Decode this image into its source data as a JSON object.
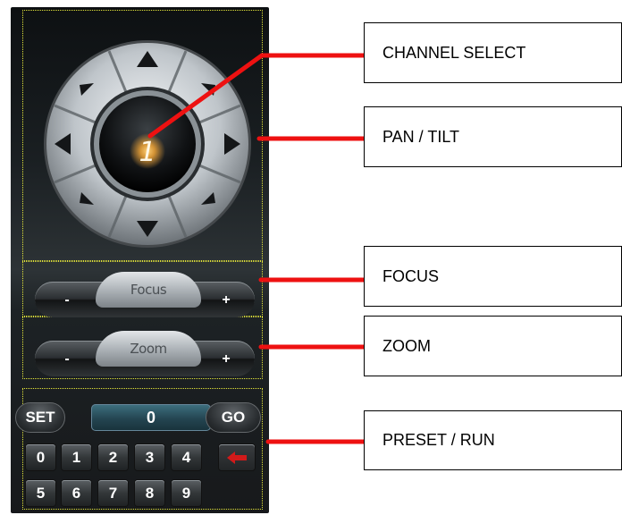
{
  "ptz": {
    "channel_number": "1"
  },
  "focus": {
    "label": "Focus",
    "minus": "-",
    "plus": "+"
  },
  "zoom": {
    "label": "Zoom",
    "minus": "-",
    "plus": "+"
  },
  "preset": {
    "set_label": "SET",
    "go_label": "GO",
    "display_value": "0",
    "keys_row1": [
      "0",
      "1",
      "2",
      "3",
      "4"
    ],
    "keys_row2": [
      "5",
      "6",
      "7",
      "8",
      "9"
    ],
    "backspace_icon": "back-arrow-icon"
  },
  "annotations": {
    "channel_select": "CHANNEL SELECT",
    "pan_tilt": "PAN / TILT",
    "focus": "FOCUS",
    "zoom": "ZOOM",
    "preset_run": "PRESET / RUN"
  },
  "colors": {
    "callout_line": "#ee1111",
    "dotted_outline": "#e4e63a",
    "channel_glow": "#f2a637",
    "backspace_arrow": "#d11a1a"
  }
}
